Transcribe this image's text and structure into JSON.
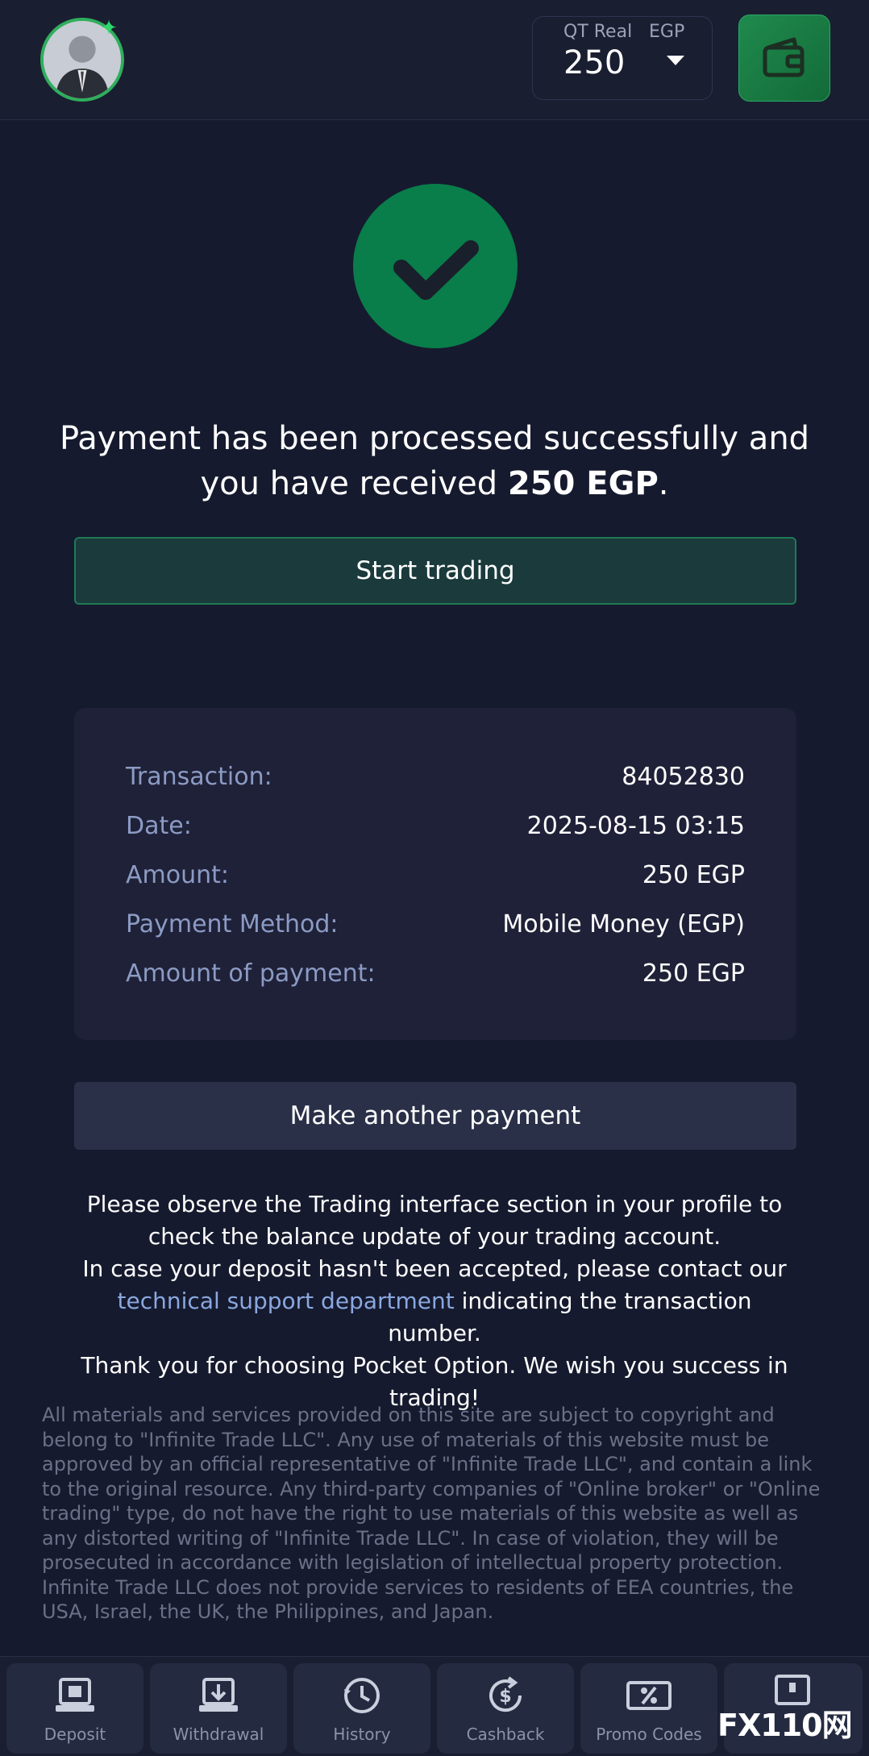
{
  "header": {
    "account_type": "QT Real",
    "currency": "EGP",
    "balance": "250"
  },
  "success": {
    "message_prefix": "Payment has been processed successfully and you have received",
    "amount": "250 EGP",
    "message_suffix": "."
  },
  "start_trading_label": "Start trading",
  "details": [
    {
      "label": "Transaction:",
      "value": "84052830"
    },
    {
      "label": "Date:",
      "value": "2025-08-15 03:15"
    },
    {
      "label": "Amount:",
      "value": "250 EGP"
    },
    {
      "label": "Payment Method:",
      "value": "Mobile Money (EGP)"
    },
    {
      "label": "Amount of payment:",
      "value": "250 EGP"
    }
  ],
  "another_payment_label": "Make another payment",
  "info": {
    "line1": "Please observe the Trading interface section in your profile to check the balance update of your trading account.",
    "line2": "In case your deposit hasn't been accepted, please contact our",
    "link": "technical support department",
    "line3": "indicating the transaction number.",
    "line4": "Thank you for choosing Pocket Option. We wish you success in trading!"
  },
  "legal": {
    "p1": "All materials and services provided on this site are subject to copyright and belong to \"Infinite Trade LLC\". Any use of materials of this website must be approved by an official representative of \"Infinite Trade LLC\", and contain a link to the original resource. Any third-party companies of \"Online broker\" or \"Online trading\" type, do not have the right to use materials of this website as well as any distorted writing of \"Infinite Trade LLC\". In case of violation, they will be prosecuted in accordance with legislation of intellectual property protection.",
    "p2": "Infinite Trade LLC does not provide services to residents of EEA countries, the USA, Israel, the UK, the Philippines, and Japan."
  },
  "bottom_nav": [
    {
      "label": "Deposit",
      "icon": "deposit-icon"
    },
    {
      "label": "Withdrawal",
      "icon": "withdrawal-icon"
    },
    {
      "label": "History",
      "icon": "history-icon"
    },
    {
      "label": "Cashback",
      "icon": "cashback-icon"
    },
    {
      "label": "Promo Codes",
      "icon": "promo-codes-icon"
    },
    {
      "label": "",
      "icon": "lock-icon"
    }
  ],
  "watermark": "FX110网",
  "colors": {
    "background": "#161a2e",
    "success_green": "#097d4a",
    "accent_green": "#2fae5c",
    "link_blue": "#8aa8e0"
  }
}
